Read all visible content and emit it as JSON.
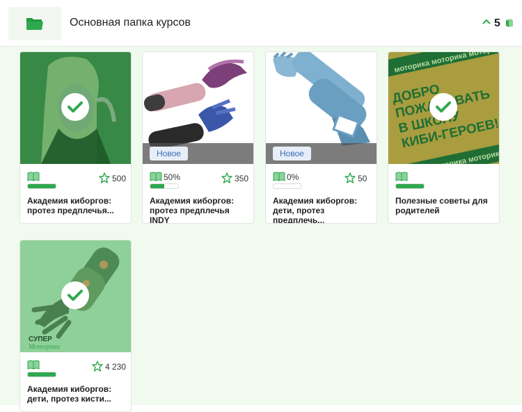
{
  "folder": {
    "title": "Основная папка курсов",
    "count": "5",
    "folder_icon": "folder-open-icon",
    "accent_color": "#2fa84f"
  },
  "cards": [
    {
      "title_line1": "Академия киборгов:",
      "title_line2": "протез предплечья...",
      "rating": "500",
      "completed": true,
      "progress_percent_label": "",
      "progress_fraction": 1.0,
      "new_badge": ""
    },
    {
      "title_line1": "Академия киборгов:",
      "title_line2": "протез предплечья INDY",
      "rating": "350",
      "completed": false,
      "progress_percent_label": "50%",
      "progress_fraction": 0.5,
      "new_badge": "Новое"
    },
    {
      "title_line1": "Академия киборгов:",
      "title_line2": "дети, протез предплечь...",
      "rating": "50",
      "completed": false,
      "progress_percent_label": "0%",
      "progress_fraction": 0.0,
      "new_badge": "Новое"
    },
    {
      "title_line1": "Полезные советы для",
      "title_line2": "родителей",
      "rating": "",
      "completed": true,
      "progress_percent_label": "",
      "progress_fraction": 1.0,
      "new_badge": "",
      "cover_text": [
        "ДОБРО",
        "ПОЖАЛОВАТЬ",
        "В ШКОЛУ",
        "КИБИ-ГЕРОЕВ!"
      ],
      "cover_band_text": "моторика моторика моторика"
    },
    {
      "title_line1": "Академия киборгов:",
      "title_line2": "дети, протез кисти...",
      "rating": "4 230",
      "completed": true,
      "progress_percent_label": "",
      "progress_fraction": 1.0,
      "new_badge": "",
      "cover_logo": [
        "СУПЕР",
        "Моторика"
      ]
    }
  ]
}
